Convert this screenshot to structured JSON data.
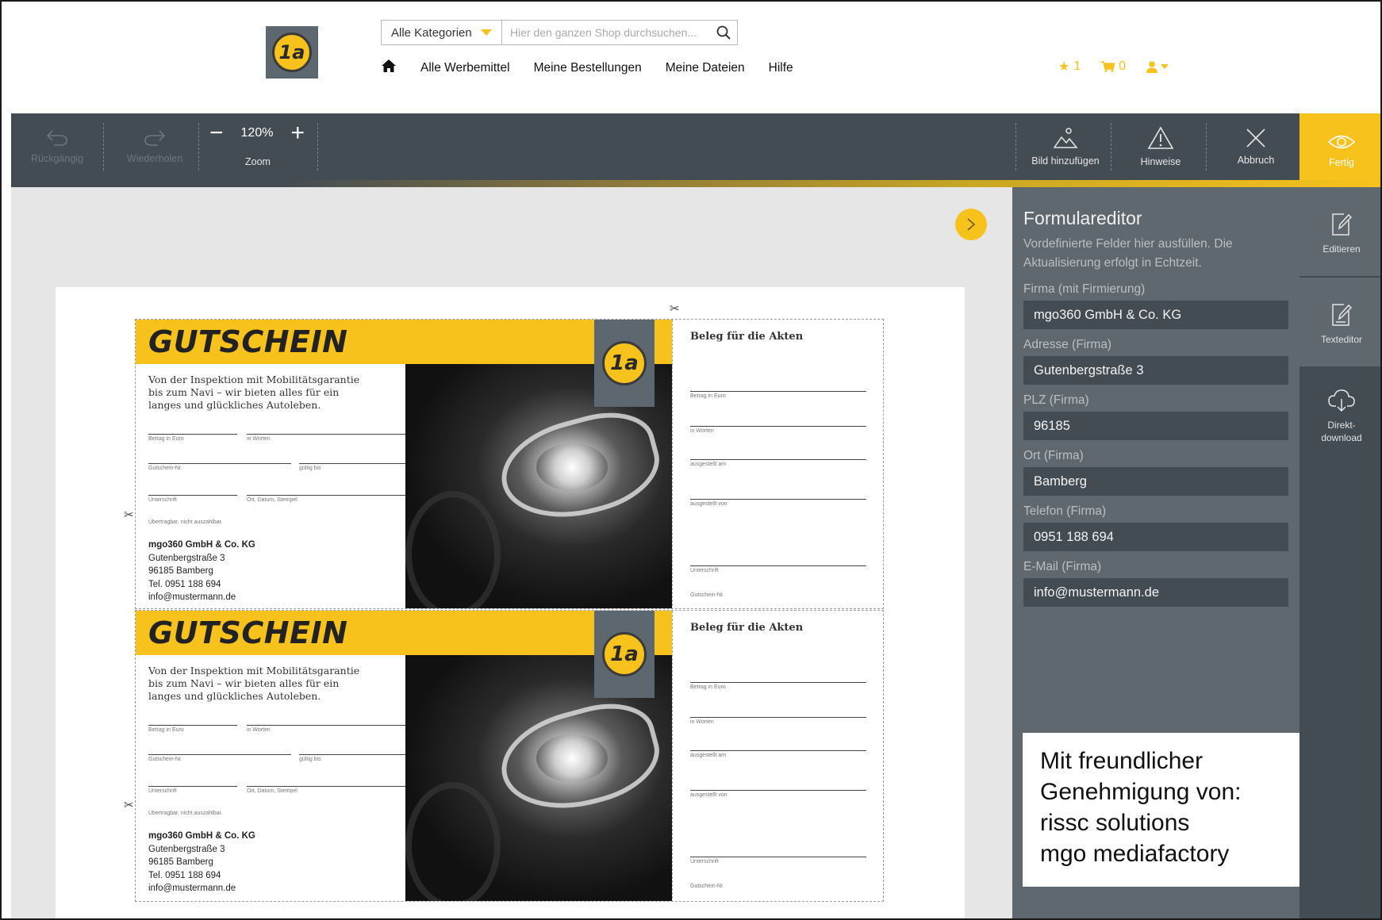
{
  "header": {
    "search": {
      "category": "Alle Kategorien",
      "placeholder": "Hier den ganzen Shop durchsuchen..."
    },
    "nav": [
      "Alle Werbemittel",
      "Meine Bestellungen",
      "Meine Dateien",
      "Hilfe"
    ],
    "favorites_count": "1",
    "cart_count": "0",
    "logo_text": "1a"
  },
  "toolbar": {
    "undo_label": "Rückgängig",
    "redo_label": "Wiederholen",
    "zoom_label": "Zoom",
    "zoom_value": "120%",
    "add_image_label": "Bild hinzufügen",
    "hints_label": "Hinweise",
    "cancel_label": "Abbruch",
    "done_label": "Fertig"
  },
  "voucher": {
    "title": "GUTSCHEIN",
    "intro": "Von der Inspektion mit Mobilitätsgarantie bis zum Navi – wir bieten alles für ein langes und glückliches Autoleben.",
    "fields": {
      "amount": "Betrag in Euro",
      "in_words": "in Worten",
      "voucher_no": "Gutschein-Nr.",
      "valid_until": "gültig bis",
      "signature": "Unterschrift",
      "place_date_stamp": "Ort, Datum, Stempel",
      "transferable": "Übertragbar, nicht auszahlbar."
    },
    "company": "mgo360 GmbH & Co. KG",
    "street": "Gutenbergstraße 3",
    "city": "96185 Bamberg",
    "phone": "Tel. 0951 188 694",
    "email": "info@mustermann.de",
    "stub": {
      "title": "Beleg für die Akten",
      "amount": "Betrag in Euro",
      "in_words": "in Worten",
      "issued_on": "ausgestellt am",
      "issued_by": "ausgestellt von",
      "signature": "Unterschrift",
      "voucher_no": "Gutschein-Nr."
    }
  },
  "form_editor": {
    "title": "Formulareditor",
    "description": "Vordefinierte Felder hier ausfüllen. Die Aktualisierung erfolgt in Echtzeit.",
    "fields": [
      {
        "label": "Firma (mit Firmierung)",
        "value": "mgo360 GmbH & Co. KG"
      },
      {
        "label": "Adresse (Firma)",
        "value": "Gutenbergstraße 3"
      },
      {
        "label": "PLZ (Firma)",
        "value": "96185"
      },
      {
        "label": "Ort (Firma)",
        "value": "Bamberg"
      },
      {
        "label": "Telefon (Firma)",
        "value": "0951 188 694"
      },
      {
        "label": "E-Mail (Firma)",
        "value": "info@mustermann.de"
      }
    ]
  },
  "side_tabs": {
    "edit": "Editieren",
    "text_editor": "Texteditor",
    "direct_download_1": "Direkt-",
    "direct_download_2": "download"
  },
  "credit": {
    "line1": "Mit freundlicher",
    "line2": "Genehmigung von:",
    "line3": "rissc solutions",
    "line4": "mgo mediafactory"
  },
  "colors": {
    "brand_yellow": "#f7c21c",
    "toolbar_dark": "#434c53",
    "panel_gray": "#5f686f"
  }
}
